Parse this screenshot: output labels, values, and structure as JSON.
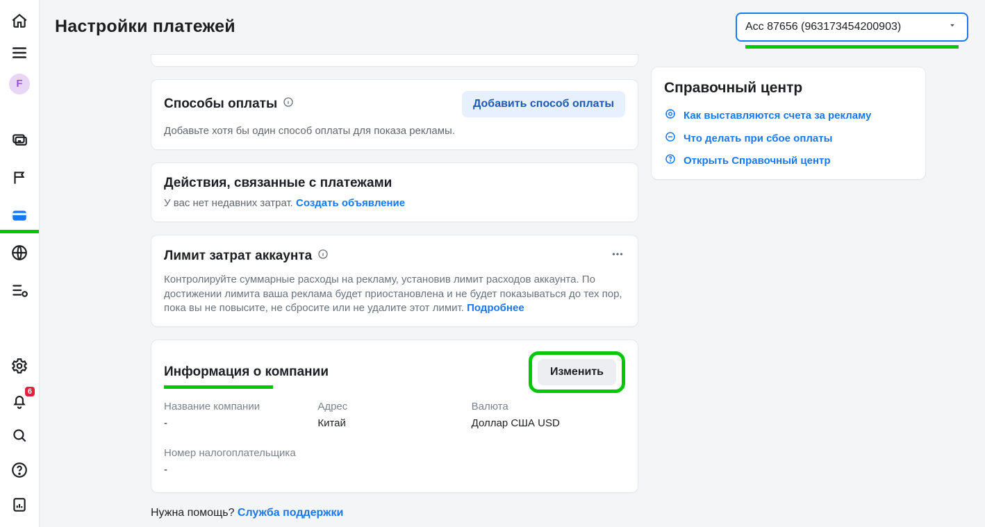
{
  "header": {
    "page_title": "Настройки платежей",
    "account_selected": "Acc 87656 (963173454200903)"
  },
  "rail": {
    "avatar_initial": "F",
    "notifications_count": "6"
  },
  "cards": {
    "payment_methods": {
      "title": "Способы оплаты",
      "add_btn": "Добавить способ оплаты",
      "sub": "Добавьте хотя бы один способ оплаты для показа рекламы."
    },
    "payment_actions": {
      "title": "Действия, связанные с платежами",
      "sub_prefix": "У вас нет недавних затрат. ",
      "create_ad": "Создать объявление"
    },
    "spend_limit": {
      "title": "Лимит затрат аккаунта",
      "desc": "Контролируйте суммарные расходы на рекламу, установив лимит расходов аккаунта. По достижении лимита ваша реклама будет приостановлена и не будет показываться до тех пор, пока вы не повысите, не сбросите или не удалите этот лимит. ",
      "more": "Подробнее"
    },
    "business_info": {
      "title": "Информация о компании",
      "edit_btn": "Изменить",
      "labels": {
        "name": "Название компании",
        "address": "Адрес",
        "currency": "Валюта",
        "tax": "Номер налогоплательщика"
      },
      "values": {
        "name": "-",
        "address": "Китай",
        "currency": "Доллар США USD",
        "tax": "-"
      }
    }
  },
  "help": {
    "title": "Справочный центр",
    "items": [
      "Как выставляются счета за рекламу",
      "Что делать при сбое оплаты",
      "Открыть Справочный центр"
    ]
  },
  "footer": {
    "prefix": "Нужна помощь? ",
    "link": "Служба поддержки"
  }
}
